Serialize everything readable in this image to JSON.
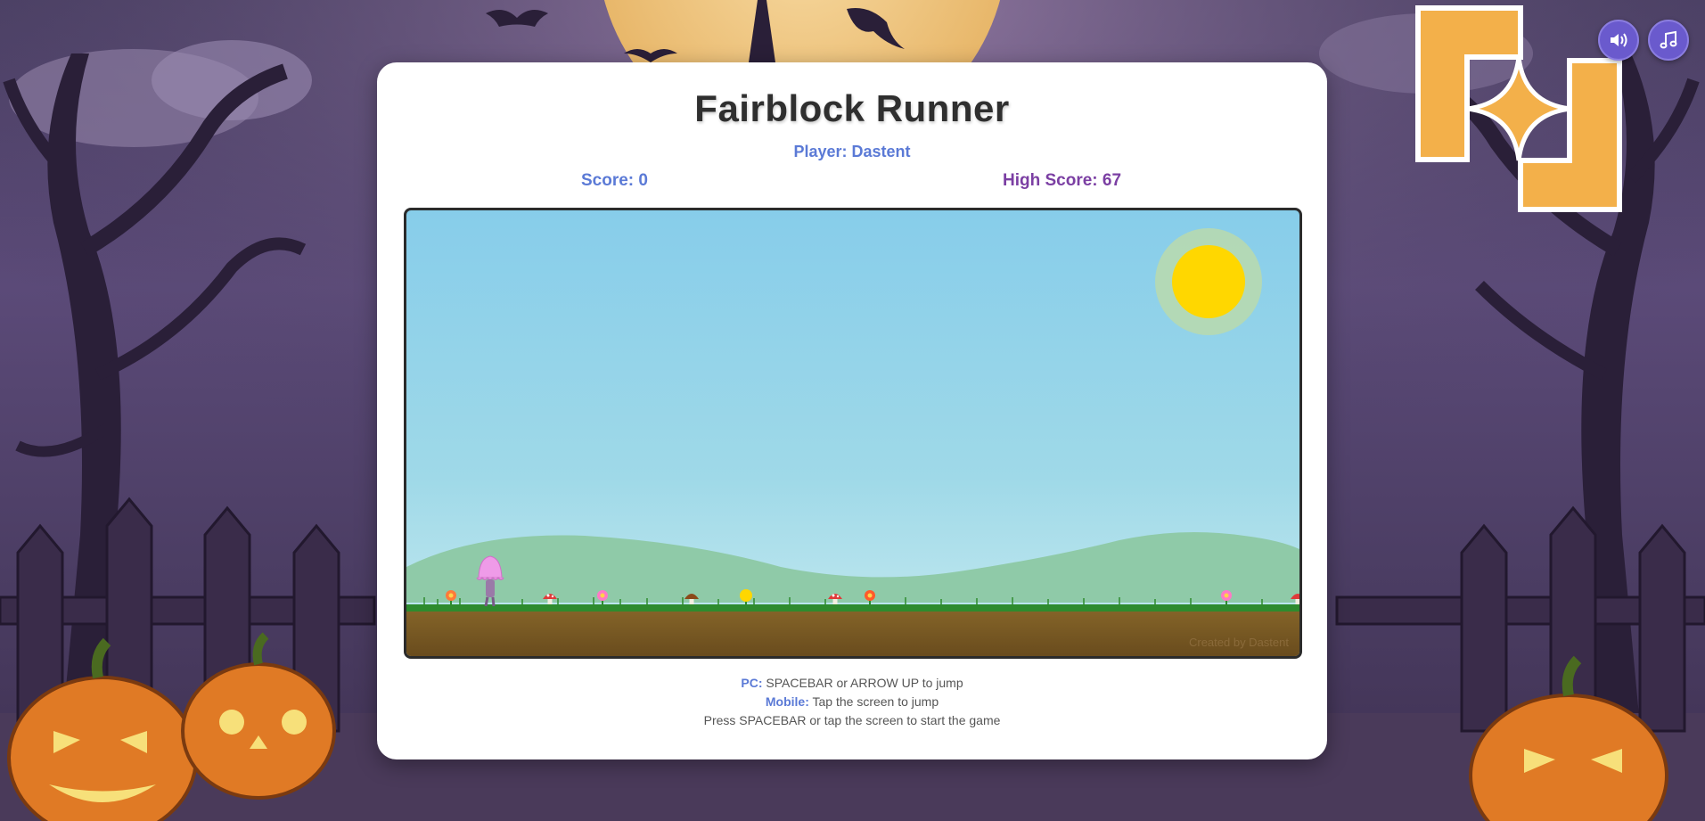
{
  "title": "Fairblock Runner",
  "player_label": "Player: Dastent",
  "score_label": "Score: 0",
  "high_score_label": "High Score: 67",
  "credit": "Created by Dastent",
  "instructions": {
    "pc_key": "PC:",
    "pc_text": "SPACEBAR or ARROW UP to jump",
    "mobile_key": "Mobile:",
    "mobile_text": "Tap the screen to jump",
    "start_text": "Press SPACEBAR or tap the screen to start the game"
  },
  "controls": {
    "sound_icon": "speaker-icon",
    "music_icon": "music-note-icon"
  },
  "colors": {
    "accent_blue": "#5b7ad6",
    "accent_purple": "#7b3fa3",
    "sky": "#87cdea",
    "sun": "#ffd700",
    "grass": "#2e8b2e",
    "dirt": "#7a5a25",
    "logo_orange": "#f3b04a"
  }
}
